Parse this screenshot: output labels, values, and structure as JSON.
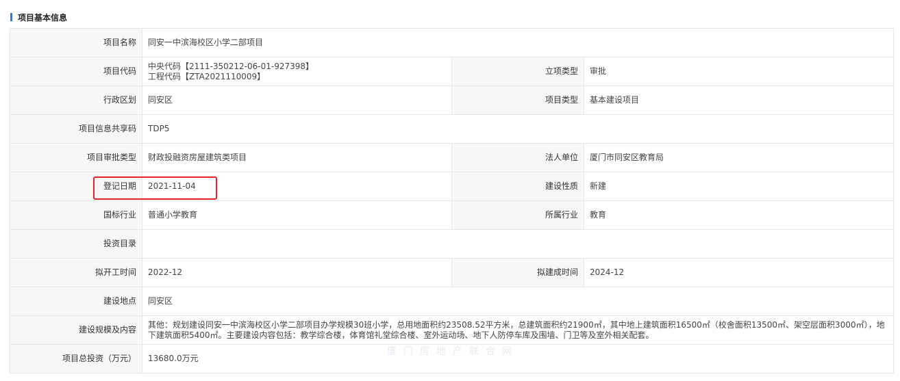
{
  "section": {
    "title": "项目基本信息"
  },
  "rows": {
    "name": {
      "label": "项目名称",
      "value": "同安一中滨海校区小学二部项目"
    },
    "code": {
      "label": "项目代码",
      "central_code": "中央代码【2111-350212-06-01-927398】",
      "project_code": "工程代码【ZTA2021110009】",
      "label2": "立项类型",
      "value2": "审批"
    },
    "district": {
      "label": "行政区划",
      "value": "同安区",
      "label2": "项目类型",
      "value2": "基本建设项目"
    },
    "share_code": {
      "label": "项目信息共享码",
      "value": "TDP5"
    },
    "approval": {
      "label": "项目审批类型",
      "value": "财政投融资房屋建筑类项目",
      "label2": "法人单位",
      "value2": "厦门市同安区教育局"
    },
    "register": {
      "label": "登记日期",
      "value": "2021-11-04",
      "label2": "建设性质",
      "value2": "新建"
    },
    "industry": {
      "label": "国标行业",
      "value": "普通小学教育",
      "label2": "所属行业",
      "value2": "教育"
    },
    "catalog": {
      "label": "投资目录",
      "value": ""
    },
    "schedule": {
      "label": "拟开工时间",
      "value": "2022-12",
      "label2": "拟建成时间",
      "value2": "2024-12"
    },
    "location": {
      "label": "建设地点",
      "value": "同安区"
    },
    "scale": {
      "label": "建设规模及内容",
      "value": "其他：规划建设同安一中滨海校区小学二部项目办学规模30班小学，总用地面积约23508.52平方米，总建筑面积约21900㎡，其中地上建筑面积16500㎡（校舍面积13500㎡、架空层面积3000㎡），地下建筑面积5400㎡。主要建设内容包括：教学综合楼，体育馆礼堂综合楼、室外运动场、地下人防停车库及围墙、门卫等及室外相关配套。"
    },
    "investment": {
      "label": "项目总投资（万元）",
      "value": "13680.0万元"
    }
  },
  "watermark": "厦门房地产联合网",
  "colors": {
    "accent": "#2a7be4",
    "highlight": "#e82323",
    "label_bg": "#f7f7f7",
    "border": "#e6e6e6"
  }
}
